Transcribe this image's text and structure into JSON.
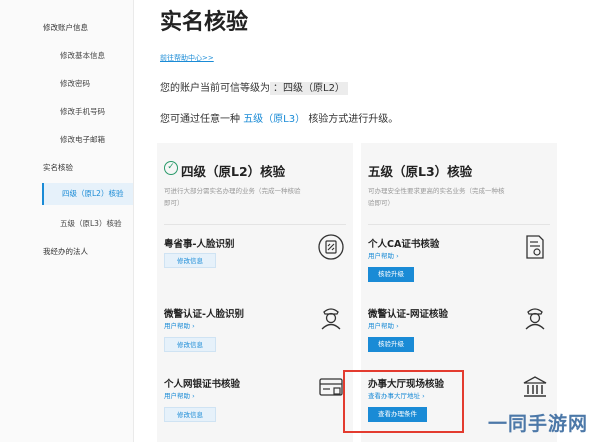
{
  "sidebar": {
    "items": [
      {
        "label": "修改账户信息"
      },
      {
        "label": "修改基本信息"
      },
      {
        "label": "修改密码"
      },
      {
        "label": "修改手机号码"
      },
      {
        "label": "修改电子邮箱"
      },
      {
        "label": "实名核验"
      },
      {
        "label": "四级（原L2）核验"
      },
      {
        "label": "五级（原L3）核验"
      },
      {
        "label": "我经办的法人"
      }
    ]
  },
  "main": {
    "title": "实名核验",
    "help_link": "前往帮助中心>>",
    "level_prefix": "您的账户当前可信等级为",
    "level_value": "：四级（原L2）",
    "upgrade_prefix": "您可通过任意一种",
    "upgrade_level": "五级（原L3）",
    "upgrade_suffix": "核验方式进行升级。"
  },
  "panels": [
    {
      "title": "四级（原L2）核验",
      "desc": "可进行大部分需实名办理的业务（完成一种核验即可）",
      "items": [
        {
          "name": "粤省事-人脸识别",
          "button": "修改信息"
        },
        {
          "name": "微警认证-人脸识别",
          "help": "用户帮助 ›",
          "button": "修改信息"
        },
        {
          "name": "个人网银证书核验",
          "help": "用户帮助 ›",
          "button": "修改信息"
        }
      ]
    },
    {
      "title": "五级（原L3）核验",
      "desc": "可办理安全性要求更高的实名业务（完成一种核验即可）",
      "items": [
        {
          "name": "个人CA证书核验",
          "help": "用户帮助 ›",
          "button": "核验升级"
        },
        {
          "name": "微警认证-网证核验",
          "help": "用户帮助 ›",
          "button": "核验升级"
        },
        {
          "name": "办事大厅现场核验",
          "help": "查看办事大厅地址 ›",
          "button": "查看办理条件"
        }
      ]
    }
  ],
  "icons": {
    "check": "check-circle-icon",
    "face_id": "face-scan-icon",
    "police": "police-officer-icon",
    "bank_card": "bank-card-icon",
    "certificate": "certificate-icon",
    "hall": "government-building-icon"
  },
  "colors": {
    "accent": "#1a8bd6",
    "highlight": "#e33b2f",
    "success": "#2a9a6a"
  },
  "watermark": "一同手游网"
}
